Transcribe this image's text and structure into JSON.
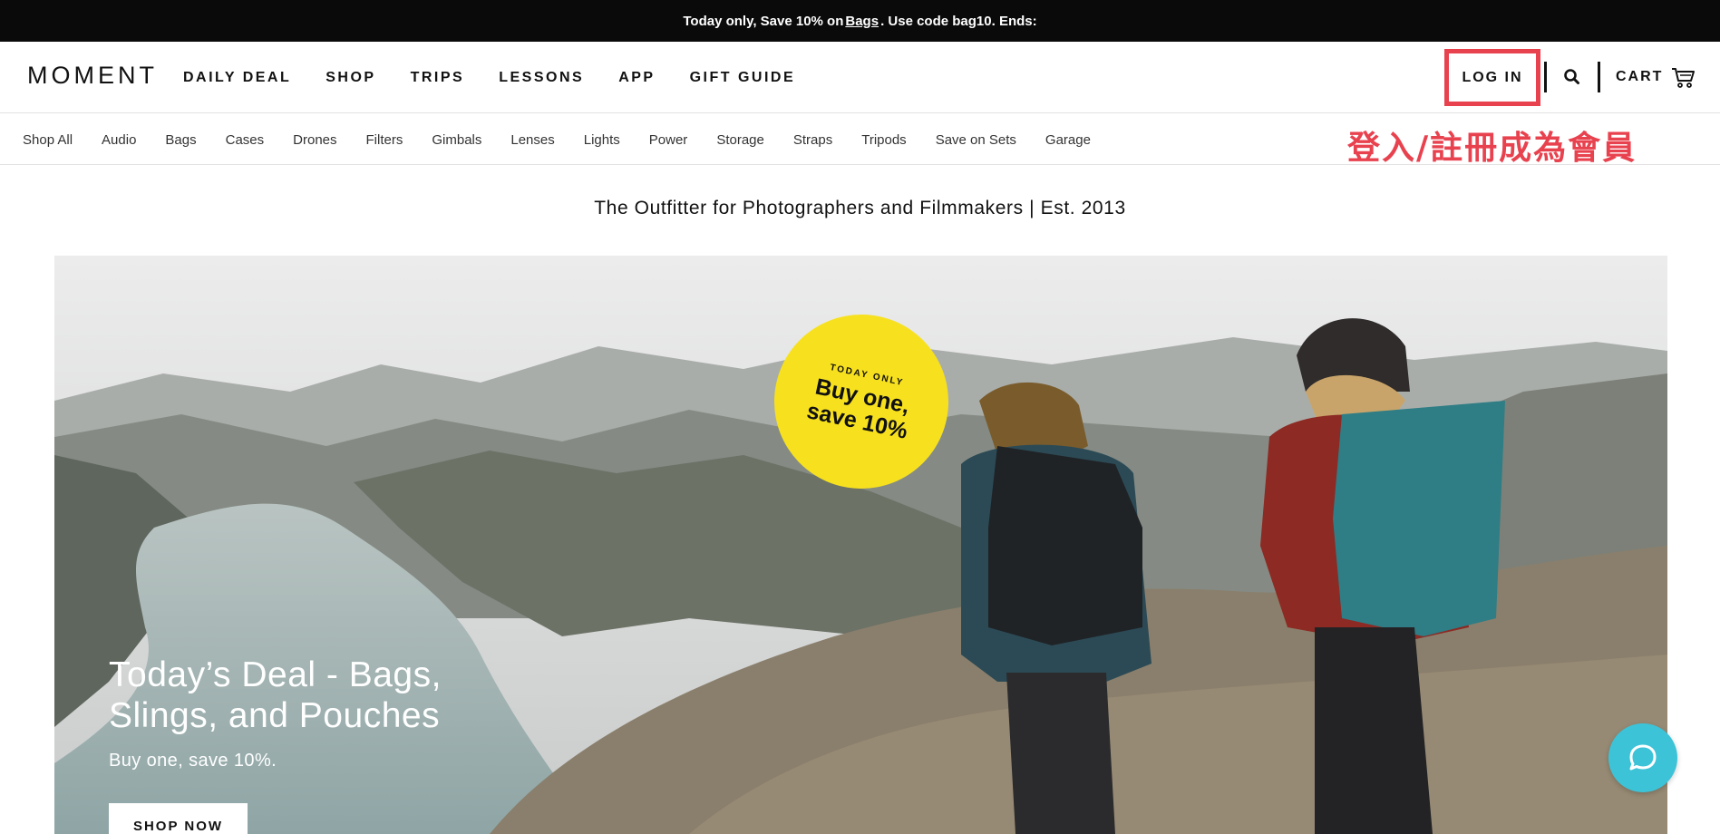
{
  "announcement": {
    "prefix": "Today only, Save 10% on ",
    "link": "Bags",
    "suffix": ". Use code bag10. Ends:"
  },
  "header": {
    "logo": "MOMENT",
    "nav": [
      "DAILY DEAL",
      "SHOP",
      "TRIPS",
      "LESSONS",
      "APP",
      "GIFT GUIDE"
    ],
    "login_label": "LOG IN",
    "search_icon": "search-icon",
    "cart_label": "CART",
    "cart_icon": "cart-icon"
  },
  "subnav": {
    "items": [
      "Shop All",
      "Audio",
      "Bags",
      "Cases",
      "Drones",
      "Filters",
      "Gimbals",
      "Lenses",
      "Lights",
      "Power",
      "Storage",
      "Straps",
      "Tripods",
      "Save on Sets",
      "Garage"
    ]
  },
  "annotation": "登入/註冊成為會員",
  "tagline": "The Outfitter for Photographers and Filmmakers | Est. 2013",
  "hero": {
    "badge_small": "TODAY ONLY",
    "badge_line1": "Buy one,",
    "badge_line2": "save 10%",
    "title": "Today’s Deal - Bags, Slings, and Pouches",
    "subtitle": "Buy one, save 10%.",
    "cta": "SHOP NOW"
  },
  "chat": {
    "icon": "chat-bubble-icon"
  },
  "colors": {
    "annotation_red": "#e8424f",
    "badge_yellow": "#f7e11e",
    "chat_teal": "#3cc3d8",
    "announce_bg": "#0a0a0a"
  }
}
